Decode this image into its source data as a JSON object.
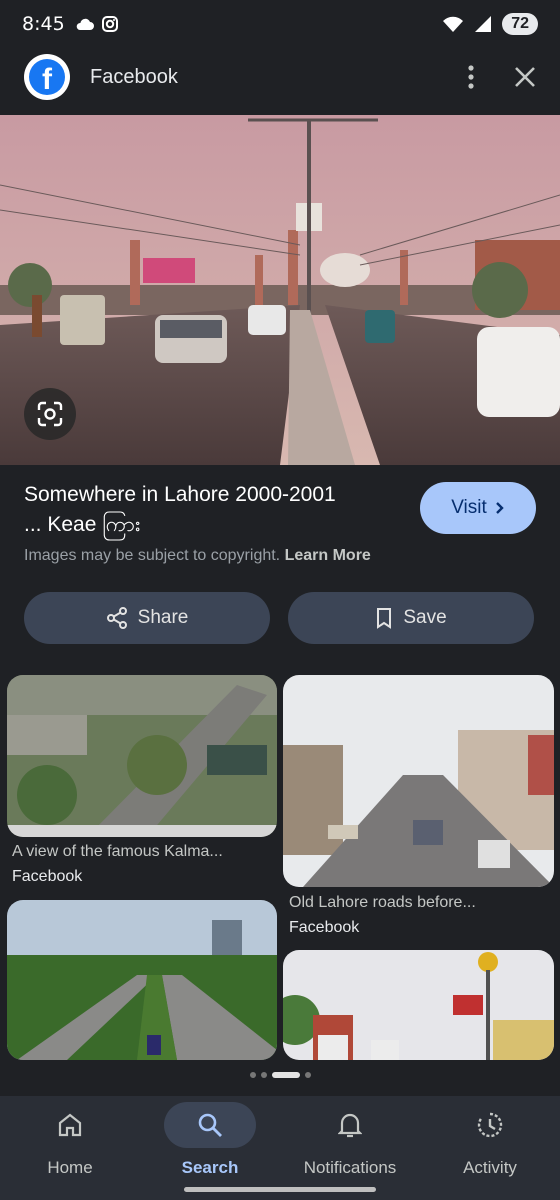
{
  "status_bar": {
    "time": "8:45",
    "battery": "72"
  },
  "header": {
    "source_name": "Facebook",
    "icons": [
      "facebook-logo",
      "more-vert-icon",
      "close-icon"
    ]
  },
  "result": {
    "title_line1": "Somewhere in Lahore 2000-2001",
    "title_line2": "... Keae ကြား",
    "visit_label": "Visit",
    "copyright_text": "Images may be subject to copyright.",
    "learn_more": "Learn More",
    "share_label": "Share",
    "save_label": "Save"
  },
  "related": [
    {
      "caption": "A view of the famous Kalma...",
      "source": "Facebook"
    },
    {
      "caption": "Old Lahore roads before...",
      "source": "Facebook"
    },
    {
      "caption": "",
      "source": ""
    },
    {
      "caption": "",
      "source": ""
    }
  ],
  "pager": {
    "count": 4,
    "active_index": 2
  },
  "bottom_nav": {
    "items": [
      {
        "label": "Home",
        "icon": "home-icon"
      },
      {
        "label": "Search",
        "icon": "search-icon",
        "active": true
      },
      {
        "label": "Notifications",
        "icon": "bell-icon"
      },
      {
        "label": "Activity",
        "icon": "activity-icon"
      }
    ]
  },
  "colors": {
    "accent": "#a8c7fa",
    "background": "#1f2125",
    "pill": "#3c4556"
  }
}
